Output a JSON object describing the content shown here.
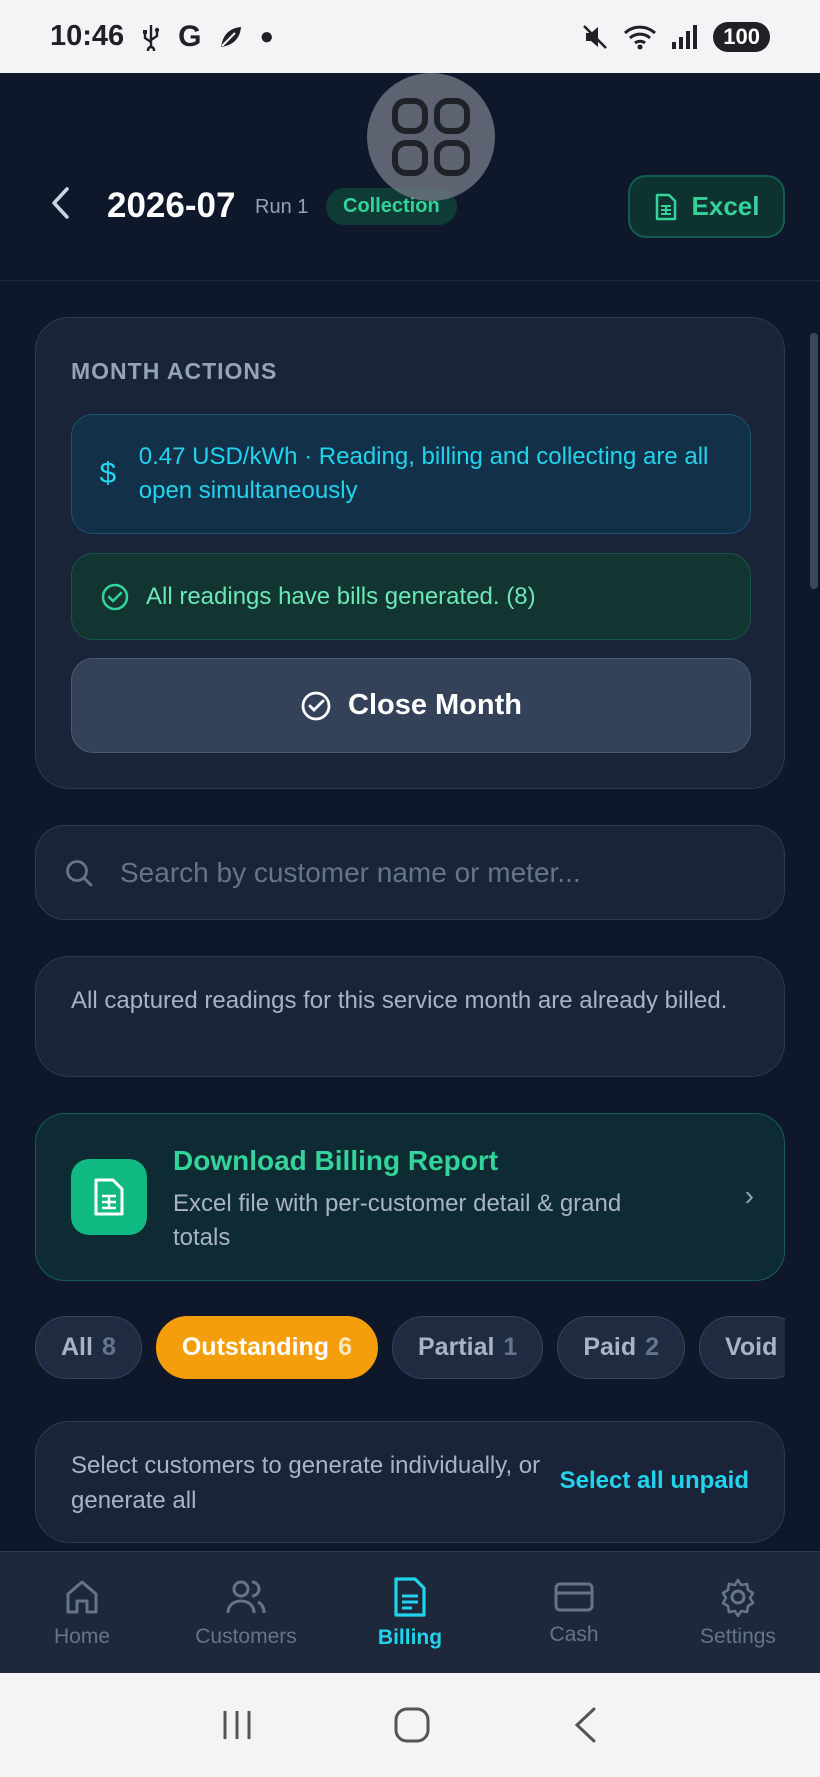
{
  "status_bar": {
    "time": "10:46",
    "notification_icons": [
      "usb-icon",
      "google-icon",
      "leaf-icon",
      "dot-icon"
    ],
    "battery": "100"
  },
  "header": {
    "title": "2026-07",
    "run_label": "Run 1",
    "phase_badge": "Collection",
    "excel_label": "Excel"
  },
  "month_actions": {
    "section_title": "MONTH ACTIONS",
    "rate_text": "0.47 USD/kWh · Reading, billing and collecting are all open simultaneously",
    "bills_text": "All readings have bills generated. (8)",
    "close_month_label": "Close Month"
  },
  "search": {
    "placeholder": "Search by customer name or meter..."
  },
  "info": {
    "text": "All captured readings for this service month are already billed."
  },
  "report": {
    "title": "Download Billing Report",
    "description": "Excel file with per-customer detail & grand totals",
    "chevron": "›"
  },
  "filters": [
    {
      "label": "All",
      "count": "8"
    },
    {
      "label": "Outstanding",
      "count": "6"
    },
    {
      "label": "Partial",
      "count": "1"
    },
    {
      "label": "Paid",
      "count": "2"
    },
    {
      "label": "Void",
      "count": ""
    }
  ],
  "active_filter": "Outstanding",
  "selection": {
    "text": "Select customers to generate individually, or generate all",
    "select_all_label": "Select all unpaid"
  },
  "bottom_nav": [
    {
      "label": "Home",
      "icon": "home-icon"
    },
    {
      "label": "Customers",
      "icon": "users-icon"
    },
    {
      "label": "Billing",
      "icon": "document-icon"
    },
    {
      "label": "Cash",
      "icon": "card-icon"
    },
    {
      "label": "Settings",
      "icon": "gear-icon"
    }
  ],
  "active_nav": "Billing",
  "colors": {
    "background": "#0f172a",
    "accent_cyan": "#22d3ee",
    "accent_green": "#34d399",
    "accent_orange": "#f59e0b"
  }
}
